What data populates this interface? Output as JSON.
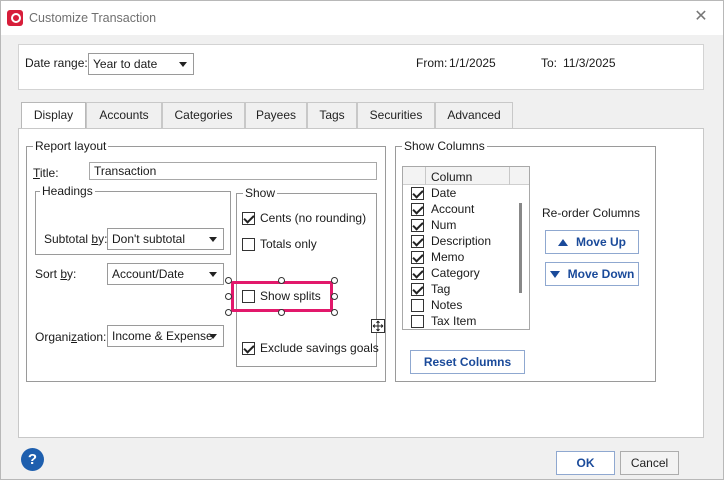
{
  "window": {
    "title": "Customize Transaction"
  },
  "date_range": {
    "label": "Date range:",
    "value": "Year to date",
    "from_label": "From:",
    "from_value": "1/1/2025",
    "to_label": "To:",
    "to_value": "11/3/2025"
  },
  "tabs": [
    {
      "label": "Display"
    },
    {
      "label": "Accounts"
    },
    {
      "label": "Categories"
    },
    {
      "label": "Payees"
    },
    {
      "label": "Tags"
    },
    {
      "label": "Securities"
    },
    {
      "label": "Advanced"
    }
  ],
  "report_layout": {
    "group_title": "Report layout",
    "title_label": "Title:",
    "title_value": "Transaction",
    "headings_title": "Headings",
    "subtotal_label": "Subtotal by:",
    "subtotal_value": "Don't subtotal",
    "sort_label": "Sort by:",
    "sort_value": "Account/Date",
    "organization_label": "Organization:",
    "organization_value": "Income & Expense"
  },
  "show": {
    "group_title": "Show",
    "items": [
      {
        "label": "Cents (no rounding)",
        "checked": true
      },
      {
        "label": "Totals only",
        "checked": false
      },
      {
        "label": "Show splits",
        "checked": false
      },
      {
        "label": "Exclude savings goals",
        "checked": true
      }
    ]
  },
  "show_columns": {
    "group_title": "Show Columns",
    "header": "Column",
    "columns": [
      {
        "label": "Date",
        "checked": true
      },
      {
        "label": "Account",
        "checked": true
      },
      {
        "label": "Num",
        "checked": true
      },
      {
        "label": "Description",
        "checked": true
      },
      {
        "label": "Memo",
        "checked": true
      },
      {
        "label": "Category",
        "checked": true
      },
      {
        "label": "Tag",
        "checked": true
      },
      {
        "label": "Notes",
        "checked": false
      },
      {
        "label": "Tax Item",
        "checked": false
      }
    ],
    "reorder_label": "Re-order Columns",
    "move_up": "Move Up",
    "move_down": "Move Down",
    "reset": "Reset Columns"
  },
  "footer": {
    "ok": "OK",
    "cancel": "Cancel"
  }
}
